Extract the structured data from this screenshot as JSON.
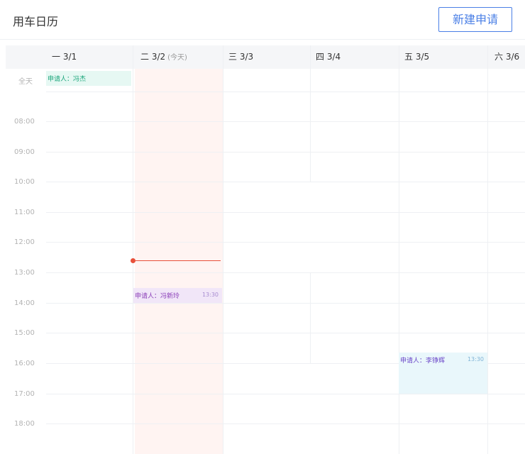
{
  "header": {
    "title": "用车日历",
    "new_button": "新建申请"
  },
  "calendar": {
    "allday_label": "全天",
    "today_tag": "(今天)",
    "days": [
      {
        "label": "一 3/1"
      },
      {
        "label": "二 3/2"
      },
      {
        "label": "三 3/3"
      },
      {
        "label": "四 3/4"
      },
      {
        "label": "五 3/5"
      },
      {
        "label": "六 3/6"
      }
    ],
    "hours": [
      "08:00",
      "09:00",
      "10:00",
      "11:00",
      "12:00",
      "13:00",
      "14:00",
      "15:00",
      "16:00",
      "17:00",
      "18:00"
    ],
    "events": {
      "allday_event": {
        "who": "申请人：冯杰"
      },
      "feng_event": {
        "who": "申请人：冯新玲",
        "time": "13:30"
      },
      "li_event": {
        "who": "申请人：李铮辉",
        "time": "13:30"
      }
    }
  },
  "colors": {
    "accent": "#4a7fe6",
    "today_bg": "#fff4f2",
    "now_line": "#e8503a",
    "event_green_bg": "#e6f8f3",
    "event_purple_bg": "#f1e6f8",
    "event_cyan_bg": "#e9f7fb"
  }
}
